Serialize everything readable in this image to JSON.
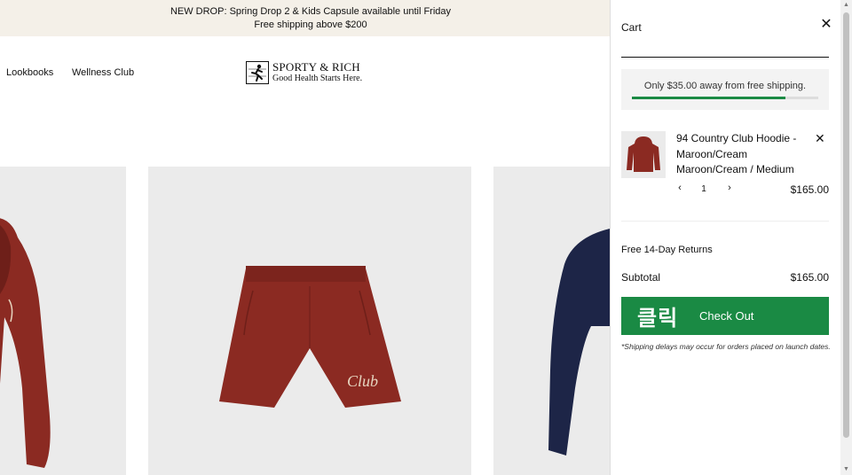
{
  "announcement": {
    "line1": "NEW DROP: Spring Drop 2 & Kids Capsule available until Friday",
    "line2": "Free shipping above $200"
  },
  "nav": {
    "lookbooks": "Lookbooks",
    "wellness": "Wellness Club"
  },
  "brand": {
    "name": "SPORTY & RICH",
    "tagline": "Good Health Starts Here."
  },
  "products": [
    {
      "icon": "maroon-hoodie",
      "color": "#8b2a22"
    },
    {
      "icon": "maroon-shorts",
      "color": "#8b2a22"
    },
    {
      "icon": "navy-hoodie",
      "color": "#1d2547"
    }
  ],
  "cart": {
    "title": "Cart",
    "shipping_message": "Only $35.00 away from free shipping.",
    "shipping_progress": 0.825,
    "accent": "#1a8a44",
    "item": {
      "name_line1": "94 Country Club Hoodie -",
      "name_line2": "Maroon/Cream",
      "variant": "Maroon/Cream / Medium",
      "quantity": "1",
      "minus": "‹",
      "plus": "›",
      "price": "$165.00"
    },
    "returns": "Free 14-Day Returns",
    "subtotal_label": "Subtotal",
    "subtotal_value": "$165.00",
    "checkout_badge": "클릭",
    "checkout_label": "Check Out",
    "shipping_note": "*Shipping delays may occur for orders placed on launch dates."
  }
}
